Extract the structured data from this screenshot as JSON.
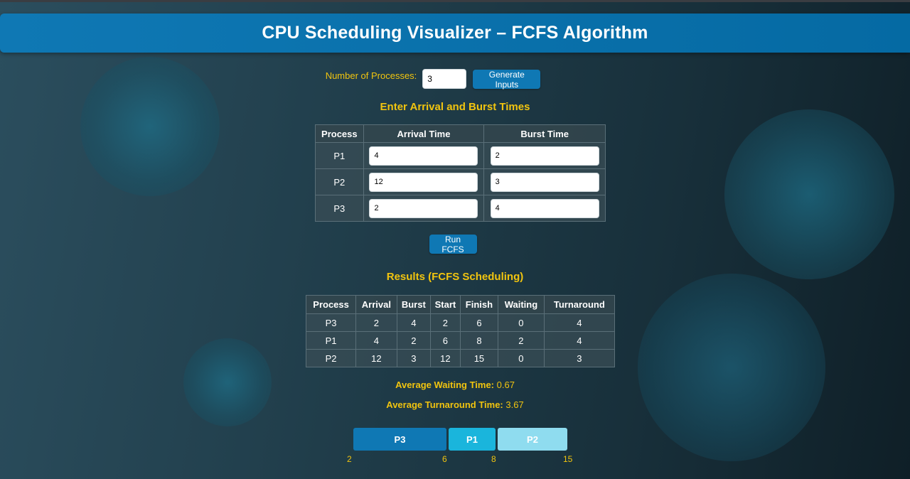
{
  "header": {
    "title": "CPU Scheduling Visualizer – FCFS Algorithm"
  },
  "controls": {
    "num_label": "Number of Processes:",
    "num_value": "3",
    "generate_label": "Generate Inputs"
  },
  "input_section": {
    "title": "Enter Arrival and Burst Times",
    "columns": [
      "Process",
      "Arrival Time",
      "Burst Time"
    ],
    "rows": [
      {
        "process": "P1",
        "arrival": "4",
        "burst": "2"
      },
      {
        "process": "P2",
        "arrival": "12",
        "burst": "3"
      },
      {
        "process": "P3",
        "arrival": "2",
        "burst": "4"
      }
    ]
  },
  "run_label": "Run FCFS",
  "results": {
    "title": "Results (FCFS Scheduling)",
    "columns": [
      "Process",
      "Arrival",
      "Burst",
      "Start",
      "Finish",
      "Waiting",
      "Turnaround"
    ],
    "rows": [
      [
        "P3",
        "2",
        "4",
        "2",
        "6",
        "0",
        "4"
      ],
      [
        "P1",
        "4",
        "2",
        "6",
        "8",
        "2",
        "4"
      ],
      [
        "P2",
        "12",
        "3",
        "12",
        "15",
        "0",
        "3"
      ]
    ],
    "avg_waiting_label": "Average Waiting Time:",
    "avg_waiting_value": "0.67",
    "avg_turnaround_label": "Average Turnaround Time:",
    "avg_turnaround_value": "3.67"
  },
  "gantt": {
    "blocks": [
      {
        "label": "P3",
        "color": "#0f78b4"
      },
      {
        "label": "P1",
        "color": "#1ab5dc"
      },
      {
        "label": "P2",
        "color": "#8fdcef"
      }
    ],
    "ticks": [
      "2",
      "6",
      "8",
      "15"
    ]
  },
  "colors": {
    "accent": "#f1c40f",
    "primary": "#0f78b4"
  }
}
